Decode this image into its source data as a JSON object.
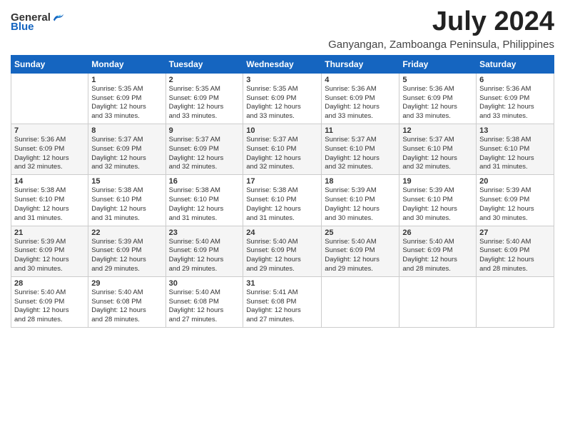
{
  "header": {
    "logo_general": "General",
    "logo_blue": "Blue",
    "month": "July 2024",
    "location": "Ganyangan, Zamboanga Peninsula, Philippines"
  },
  "days_of_week": [
    "Sunday",
    "Monday",
    "Tuesday",
    "Wednesday",
    "Thursday",
    "Friday",
    "Saturday"
  ],
  "weeks": [
    [
      {
        "day": "",
        "info": ""
      },
      {
        "day": "1",
        "info": "Sunrise: 5:35 AM\nSunset: 6:09 PM\nDaylight: 12 hours\nand 33 minutes."
      },
      {
        "day": "2",
        "info": "Sunrise: 5:35 AM\nSunset: 6:09 PM\nDaylight: 12 hours\nand 33 minutes."
      },
      {
        "day": "3",
        "info": "Sunrise: 5:35 AM\nSunset: 6:09 PM\nDaylight: 12 hours\nand 33 minutes."
      },
      {
        "day": "4",
        "info": "Sunrise: 5:36 AM\nSunset: 6:09 PM\nDaylight: 12 hours\nand 33 minutes."
      },
      {
        "day": "5",
        "info": "Sunrise: 5:36 AM\nSunset: 6:09 PM\nDaylight: 12 hours\nand 33 minutes."
      },
      {
        "day": "6",
        "info": "Sunrise: 5:36 AM\nSunset: 6:09 PM\nDaylight: 12 hours\nand 33 minutes."
      }
    ],
    [
      {
        "day": "7",
        "info": "Sunrise: 5:36 AM\nSunset: 6:09 PM\nDaylight: 12 hours\nand 32 minutes."
      },
      {
        "day": "8",
        "info": "Sunrise: 5:37 AM\nSunset: 6:09 PM\nDaylight: 12 hours\nand 32 minutes."
      },
      {
        "day": "9",
        "info": "Sunrise: 5:37 AM\nSunset: 6:09 PM\nDaylight: 12 hours\nand 32 minutes."
      },
      {
        "day": "10",
        "info": "Sunrise: 5:37 AM\nSunset: 6:10 PM\nDaylight: 12 hours\nand 32 minutes."
      },
      {
        "day": "11",
        "info": "Sunrise: 5:37 AM\nSunset: 6:10 PM\nDaylight: 12 hours\nand 32 minutes."
      },
      {
        "day": "12",
        "info": "Sunrise: 5:37 AM\nSunset: 6:10 PM\nDaylight: 12 hours\nand 32 minutes."
      },
      {
        "day": "13",
        "info": "Sunrise: 5:38 AM\nSunset: 6:10 PM\nDaylight: 12 hours\nand 31 minutes."
      }
    ],
    [
      {
        "day": "14",
        "info": "Sunrise: 5:38 AM\nSunset: 6:10 PM\nDaylight: 12 hours\nand 31 minutes."
      },
      {
        "day": "15",
        "info": "Sunrise: 5:38 AM\nSunset: 6:10 PM\nDaylight: 12 hours\nand 31 minutes."
      },
      {
        "day": "16",
        "info": "Sunrise: 5:38 AM\nSunset: 6:10 PM\nDaylight: 12 hours\nand 31 minutes."
      },
      {
        "day": "17",
        "info": "Sunrise: 5:38 AM\nSunset: 6:10 PM\nDaylight: 12 hours\nand 31 minutes."
      },
      {
        "day": "18",
        "info": "Sunrise: 5:39 AM\nSunset: 6:10 PM\nDaylight: 12 hours\nand 30 minutes."
      },
      {
        "day": "19",
        "info": "Sunrise: 5:39 AM\nSunset: 6:10 PM\nDaylight: 12 hours\nand 30 minutes."
      },
      {
        "day": "20",
        "info": "Sunrise: 5:39 AM\nSunset: 6:09 PM\nDaylight: 12 hours\nand 30 minutes."
      }
    ],
    [
      {
        "day": "21",
        "info": "Sunrise: 5:39 AM\nSunset: 6:09 PM\nDaylight: 12 hours\nand 30 minutes."
      },
      {
        "day": "22",
        "info": "Sunrise: 5:39 AM\nSunset: 6:09 PM\nDaylight: 12 hours\nand 29 minutes."
      },
      {
        "day": "23",
        "info": "Sunrise: 5:40 AM\nSunset: 6:09 PM\nDaylight: 12 hours\nand 29 minutes."
      },
      {
        "day": "24",
        "info": "Sunrise: 5:40 AM\nSunset: 6:09 PM\nDaylight: 12 hours\nand 29 minutes."
      },
      {
        "day": "25",
        "info": "Sunrise: 5:40 AM\nSunset: 6:09 PM\nDaylight: 12 hours\nand 29 minutes."
      },
      {
        "day": "26",
        "info": "Sunrise: 5:40 AM\nSunset: 6:09 PM\nDaylight: 12 hours\nand 28 minutes."
      },
      {
        "day": "27",
        "info": "Sunrise: 5:40 AM\nSunset: 6:09 PM\nDaylight: 12 hours\nand 28 minutes."
      }
    ],
    [
      {
        "day": "28",
        "info": "Sunrise: 5:40 AM\nSunset: 6:09 PM\nDaylight: 12 hours\nand 28 minutes."
      },
      {
        "day": "29",
        "info": "Sunrise: 5:40 AM\nSunset: 6:08 PM\nDaylight: 12 hours\nand 28 minutes."
      },
      {
        "day": "30",
        "info": "Sunrise: 5:40 AM\nSunset: 6:08 PM\nDaylight: 12 hours\nand 27 minutes."
      },
      {
        "day": "31",
        "info": "Sunrise: 5:41 AM\nSunset: 6:08 PM\nDaylight: 12 hours\nand 27 minutes."
      },
      {
        "day": "",
        "info": ""
      },
      {
        "day": "",
        "info": ""
      },
      {
        "day": "",
        "info": ""
      }
    ]
  ]
}
